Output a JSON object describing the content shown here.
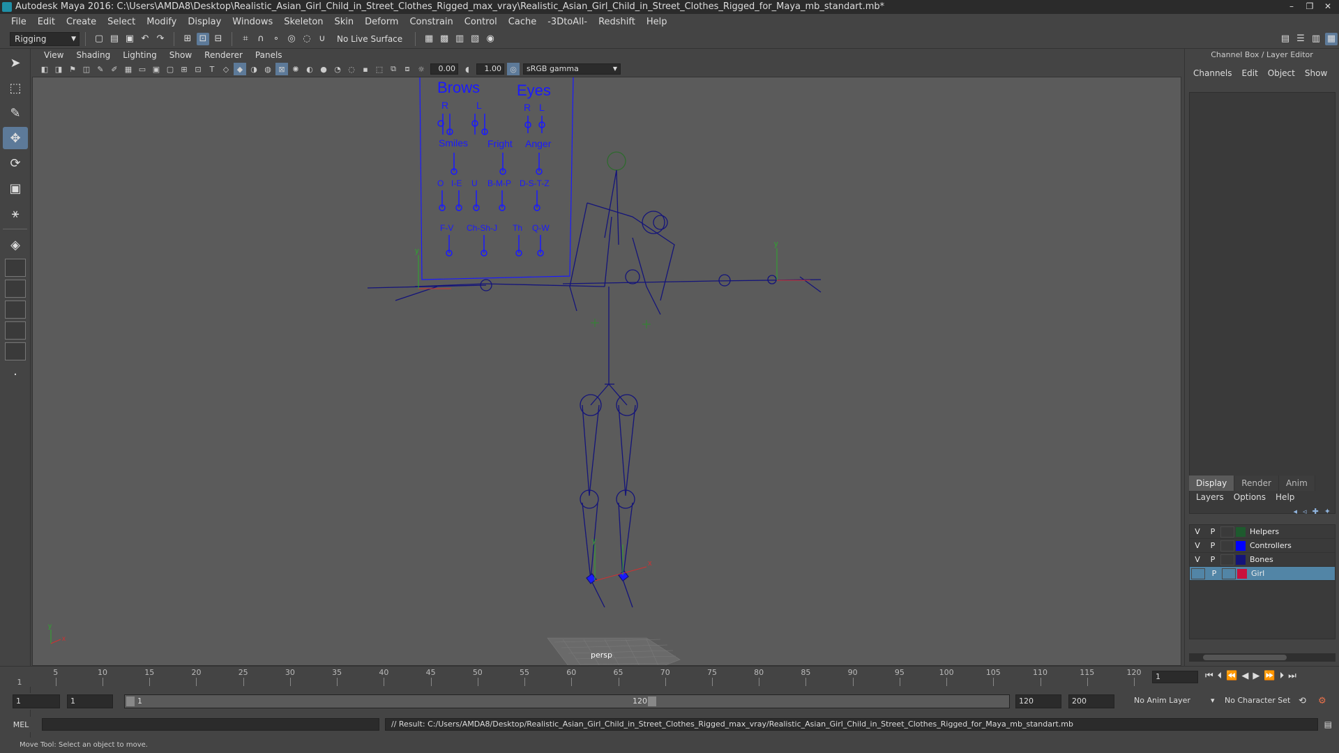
{
  "window": {
    "title": "Autodesk Maya 2016: C:\\Users\\AMDA8\\Desktop\\Realistic_Asian_Girl_Child_in_Street_Clothes_Rigged_max_vray\\Realistic_Asian_Girl_Child_in_Street_Clothes_Rigged_for_Maya_mb_standart.mb*",
    "controls": [
      "–",
      "❐",
      "✕"
    ]
  },
  "menubar": [
    "File",
    "Edit",
    "Create",
    "Select",
    "Modify",
    "Display",
    "Windows",
    "Skeleton",
    "Skin",
    "Deform",
    "Constrain",
    "Control",
    "Cache",
    "-3DtoAll-",
    "Redshift",
    "Help"
  ],
  "shelf": {
    "mode": "Rigging",
    "live_surface": "No Live Surface"
  },
  "viewport": {
    "menu": [
      "View",
      "Shading",
      "Lighting",
      "Show",
      "Renderer",
      "Panels"
    ],
    "exposure": "0.00",
    "gamma": "1.00",
    "color_space": "sRGB gamma",
    "camera_label": "persp",
    "face_rig": {
      "brows": "Brows",
      "eyes": "Eyes",
      "r": "R",
      "l": "L",
      "smiles": "Smiles",
      "fright": "Fright",
      "anger": "Anger",
      "o": "O",
      "ie": "I-E",
      "u": "U",
      "bmp": "B-M-P",
      "dstz": "D-S-T-Z",
      "fv": "F-V",
      "chshj": "Ch-Sh-J",
      "th": "Th",
      "qw": "Q-W"
    },
    "axis_x": "x",
    "axis_y": "y",
    "axis_z": "z",
    "colors": {
      "rig": "#1a1aff",
      "bones": "#14147a",
      "background": "#5b5b5b"
    }
  },
  "channel_box": {
    "title": "Channel Box / Layer Editor",
    "menu": [
      "Channels",
      "Edit",
      "Object",
      "Show"
    ],
    "layer_tabs": [
      "Display",
      "Render",
      "Anim"
    ],
    "layer_menu": [
      "Layers",
      "Options",
      "Help"
    ],
    "layers": [
      {
        "v": "V",
        "p": "P",
        "name": "Helpers",
        "color": "#1e5a2e"
      },
      {
        "v": "V",
        "p": "P",
        "name": "Controllers",
        "color": "#0000ff"
      },
      {
        "v": "V",
        "p": "P",
        "name": "Bones",
        "color": "#14147a"
      },
      {
        "v": "",
        "p": "P",
        "name": "Girl",
        "color": "#c8103c"
      }
    ]
  },
  "timeline": {
    "ticks": [
      "5",
      "10",
      "15",
      "20",
      "25",
      "30",
      "35",
      "40",
      "45",
      "50",
      "55",
      "60",
      "65",
      "70",
      "75",
      "80",
      "85",
      "90",
      "95",
      "100",
      "105",
      "110",
      "115",
      "120"
    ],
    "start_label": "1",
    "current_frame": "1"
  },
  "range": {
    "start": "1",
    "start2": "1",
    "bar_start": "1",
    "bar_end": "120",
    "end": "120",
    "end2": "200",
    "anim_layer": "No Anim Layer",
    "char_set": "No Character Set"
  },
  "command": {
    "lang": "MEL",
    "result": "// Result: C:/Users/AMDA8/Desktop/Realistic_Asian_Girl_Child_in_Street_Clothes_Rigged_max_vray/Realistic_Asian_Girl_Child_in_Street_Clothes_Rigged_for_Maya_mb_standart.mb"
  },
  "help_line": "Move Tool: Select an object to move."
}
